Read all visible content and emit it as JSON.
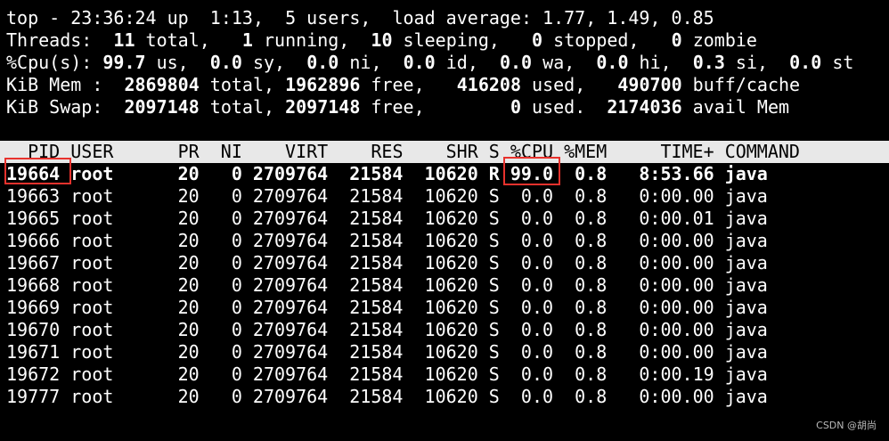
{
  "summary": [
    [
      [
        "top - 23:36:24 up  1:13,  5 users,  load average: 1.77, 1.49, 0.85",
        false
      ]
    ],
    [
      [
        "Threads: ",
        false
      ],
      [
        " 11",
        true
      ],
      [
        " total,",
        false
      ],
      [
        "   1",
        true
      ],
      [
        " running,",
        false
      ],
      [
        "  10",
        true
      ],
      [
        " sleeping,",
        false
      ],
      [
        "   0",
        true
      ],
      [
        " stopped,",
        false
      ],
      [
        "   0",
        true
      ],
      [
        " zombie",
        false
      ]
    ],
    [
      [
        "%Cpu(s):",
        false
      ],
      [
        " 99.7",
        true
      ],
      [
        " us,",
        false
      ],
      [
        "  0.0",
        true
      ],
      [
        " sy,",
        false
      ],
      [
        "  0.0",
        true
      ],
      [
        " ni,",
        false
      ],
      [
        "  0.0",
        true
      ],
      [
        " id,",
        false
      ],
      [
        "  0.0",
        true
      ],
      [
        " wa,",
        false
      ],
      [
        "  0.0",
        true
      ],
      [
        " hi,",
        false
      ],
      [
        "  0.3",
        true
      ],
      [
        " si,",
        false
      ],
      [
        "  0.0",
        true
      ],
      [
        " st",
        false
      ]
    ],
    [
      [
        "KiB Mem : ",
        false
      ],
      [
        " 2869804",
        true
      ],
      [
        " total,",
        false
      ],
      [
        " 1962896",
        true
      ],
      [
        " free,",
        false
      ],
      [
        "   416208",
        true
      ],
      [
        " used,",
        false
      ],
      [
        "   490700",
        true
      ],
      [
        " buff/cache",
        false
      ]
    ],
    [
      [
        "KiB Swap: ",
        false
      ],
      [
        " 2097148",
        true
      ],
      [
        " total,",
        false
      ],
      [
        " 2097148",
        true
      ],
      [
        " free,",
        false
      ],
      [
        "        0",
        true
      ],
      [
        " used.",
        false
      ],
      [
        "  2174036",
        true
      ],
      [
        " avail Mem",
        false
      ]
    ]
  ],
  "table": {
    "headers": [
      "PID",
      "USER",
      "PR",
      "NI",
      "VIRT",
      "RES",
      "SHR",
      "S",
      "%CPU",
      "%MEM",
      "TIME+",
      "COMMAND"
    ],
    "rows": [
      [
        "19664",
        "root",
        "20",
        "0",
        "2709764",
        "21584",
        "10620",
        "R",
        "99.0",
        "0.8",
        "8:53.66",
        "java"
      ],
      [
        "19663",
        "root",
        "20",
        "0",
        "2709764",
        "21584",
        "10620",
        "S",
        "0.0",
        "0.8",
        "0:00.00",
        "java"
      ],
      [
        "19665",
        "root",
        "20",
        "0",
        "2709764",
        "21584",
        "10620",
        "S",
        "0.0",
        "0.8",
        "0:00.01",
        "java"
      ],
      [
        "19666",
        "root",
        "20",
        "0",
        "2709764",
        "21584",
        "10620",
        "S",
        "0.0",
        "0.8",
        "0:00.00",
        "java"
      ],
      [
        "19667",
        "root",
        "20",
        "0",
        "2709764",
        "21584",
        "10620",
        "S",
        "0.0",
        "0.8",
        "0:00.00",
        "java"
      ],
      [
        "19668",
        "root",
        "20",
        "0",
        "2709764",
        "21584",
        "10620",
        "S",
        "0.0",
        "0.8",
        "0:00.00",
        "java"
      ],
      [
        "19669",
        "root",
        "20",
        "0",
        "2709764",
        "21584",
        "10620",
        "S",
        "0.0",
        "0.8",
        "0:00.00",
        "java"
      ],
      [
        "19670",
        "root",
        "20",
        "0",
        "2709764",
        "21584",
        "10620",
        "S",
        "0.0",
        "0.8",
        "0:00.00",
        "java"
      ],
      [
        "19671",
        "root",
        "20",
        "0",
        "2709764",
        "21584",
        "10620",
        "S",
        "0.0",
        "0.8",
        "0:00.00",
        "java"
      ],
      [
        "19672",
        "root",
        "20",
        "0",
        "2709764",
        "21584",
        "10620",
        "S",
        "0.0",
        "0.8",
        "0:00.19",
        "java"
      ],
      [
        "19777",
        "root",
        "20",
        "0",
        "2709764",
        "21584",
        "10620",
        "S",
        "0.0",
        "0.8",
        "0:00.00",
        "java"
      ]
    ],
    "bold_row": 0
  },
  "watermark": "CSDN @胡尚",
  "colors": {
    "background": "#000000",
    "text": "#ffffff",
    "header_bar": "#e8e8e8",
    "highlight_box": "#e8322d"
  }
}
